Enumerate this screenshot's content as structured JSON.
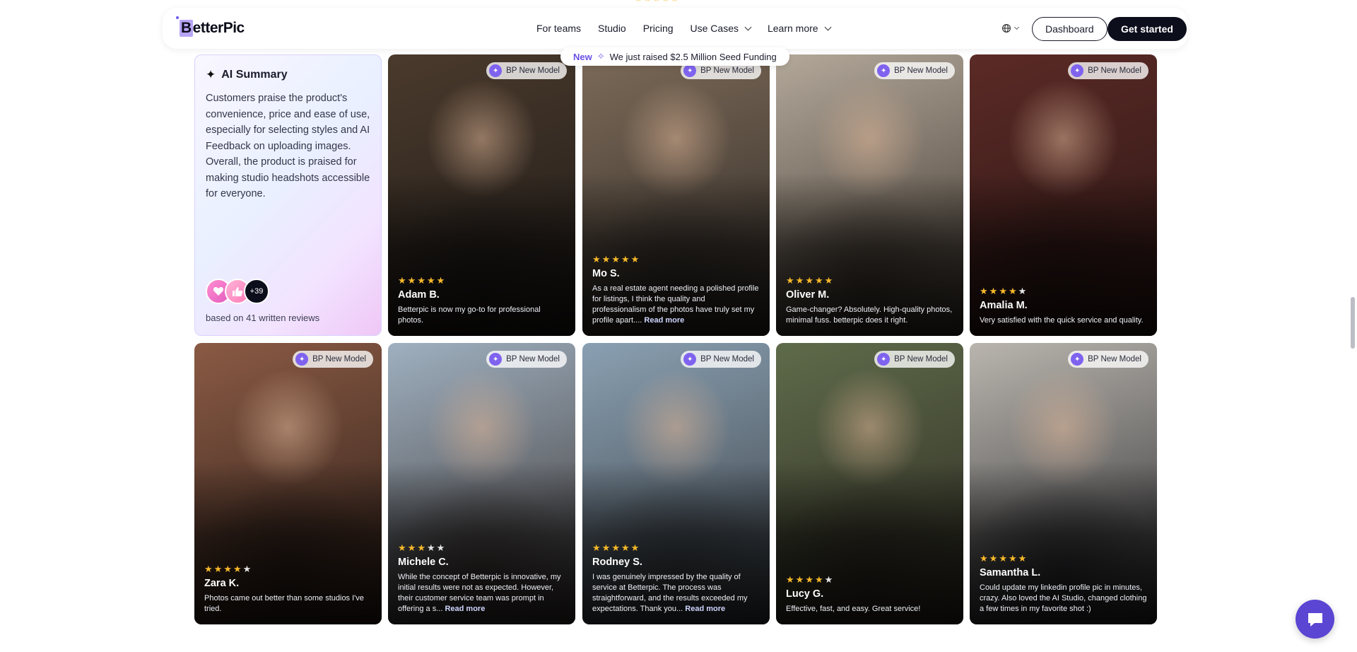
{
  "brand": {
    "name_first": "B",
    "name_rest": "etterPic",
    "accent": "#6b5cf0"
  },
  "nav": {
    "items": [
      {
        "label": "For teams",
        "dropdown": false
      },
      {
        "label": "Studio",
        "dropdown": false
      },
      {
        "label": "Pricing",
        "dropdown": false
      },
      {
        "label": "Use Cases",
        "dropdown": true
      },
      {
        "label": "Learn more",
        "dropdown": true
      }
    ],
    "dashboard_label": "Dashboard",
    "cta_label": "Get started",
    "language_icon": "globe-icon"
  },
  "announcement": {
    "tag": "New",
    "text": "We just raised $2.5 Million Seed Funding"
  },
  "ai_summary": {
    "title": "AI Summary",
    "text": "Customers praise the product's convenience, price and ease of use, especially for selecting styles and AI Feedback on uploading images. Overall, the product is praised for making studio headshots accessible for everyone.",
    "extra_count": "+39",
    "based_on": "based on 41 written reviews"
  },
  "badge_label": "BP New Model",
  "read_more_label": "Read more",
  "reviews": [
    {
      "name": "Adam B.",
      "rating": 5,
      "quote": "Betterpic is now my go-to for professional photos.",
      "truncated": false,
      "bg": "#4a3a2c",
      "bg2": "#1e1a18"
    },
    {
      "name": "Mo S.",
      "rating": 5,
      "quote": "As a real estate agent needing a polished profile for listings, I think the quality and professionalism of the photos have truly set my profile apart....",
      "truncated": true,
      "bg": "#7c6a58",
      "bg2": "#2f2a26"
    },
    {
      "name": "Oliver M.",
      "rating": 5,
      "quote": "Game-changer? Absolutely. High-quality photos, minimal fuss. betterpic does it right.",
      "truncated": false,
      "bg": "#b3a89a",
      "bg2": "#3c342c"
    },
    {
      "name": "Amalia M.",
      "rating": 4,
      "quote": "Very satisfied with the quick service and quality.",
      "truncated": false,
      "bg": "#5b2a26",
      "bg2": "#2a1614"
    },
    {
      "name": "Zara K.",
      "rating": 4,
      "quote": "Photos came out better than some studios I've tried.",
      "truncated": false,
      "bg": "#8a5a44",
      "bg2": "#2c1e18"
    },
    {
      "name": "Michele C.",
      "rating": 3,
      "quote": "While the concept of Betterpic is innovative, my initial results were not as expected. However, their customer service team was prompt in offering a s...",
      "truncated": true,
      "bg": "#9fb0c0",
      "bg2": "#3b3432"
    },
    {
      "name": "Rodney S.",
      "rating": 5,
      "quote": "I was genuinely impressed by the quality of service at Betterpic. The process was straightforward, and the results exceeded my expectations. Thank you...",
      "truncated": true,
      "bg": "#8aa0b2",
      "bg2": "#3a3f44"
    },
    {
      "name": "Lucy G.",
      "rating": 4,
      "quote": "Effective, fast, and easy. Great service!",
      "truncated": false,
      "bg": "#5e6b4a",
      "bg2": "#2e2a22"
    },
    {
      "name": "Samantha L.",
      "rating": 5,
      "quote": "Could update my linkedin profile pic in minutes, crazy. Also loved the AI Studio, changed clothing a few times in my favorite shot :)",
      "truncated": false,
      "bg": "#b9b5ae",
      "bg2": "#2c2c30"
    }
  ]
}
